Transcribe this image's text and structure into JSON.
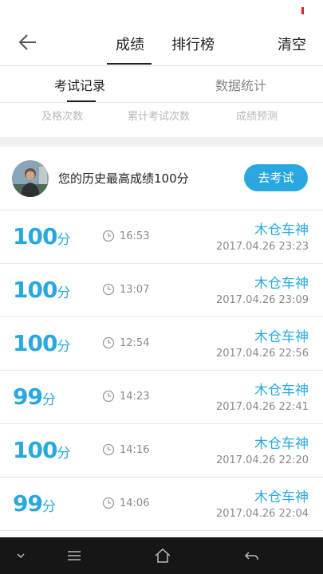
{
  "header": {
    "tabs": [
      {
        "label": "成绩",
        "active": true
      },
      {
        "label": "排行榜",
        "active": false
      }
    ],
    "clear_label": "清空"
  },
  "subtabs": [
    {
      "label": "考试记录",
      "active": true
    },
    {
      "label": "数据统计",
      "active": false
    }
  ],
  "stats_labels": [
    "及格次数",
    "累计考试次数",
    "成绩预测"
  ],
  "best": {
    "text": "您的历史最高成绩100分",
    "button_label": "去考试"
  },
  "records": [
    {
      "score": "100",
      "unit": "分",
      "duration": "16:53",
      "user": "木仓车神",
      "datetime": "2017.04.26  23:23"
    },
    {
      "score": "100",
      "unit": "分",
      "duration": "13:07",
      "user": "木仓车神",
      "datetime": "2017.04.26  23:09"
    },
    {
      "score": "100",
      "unit": "分",
      "duration": "12:54",
      "user": "木仓车神",
      "datetime": "2017.04.26  22:56"
    },
    {
      "score": "99",
      "unit": "分",
      "duration": "14:23",
      "user": "木仓车神",
      "datetime": "2017.04.26  22:41"
    },
    {
      "score": "100",
      "unit": "分",
      "duration": "14:16",
      "user": "木仓车神",
      "datetime": "2017.04.26  22:20"
    },
    {
      "score": "99",
      "unit": "分",
      "duration": "14:06",
      "user": "木仓车神",
      "datetime": "2017.04.26  22:04"
    }
  ],
  "colors": {
    "accent": "#29a8df",
    "navbar": "#161616"
  },
  "icons": {
    "back": "back-arrow-icon",
    "clock": "clock-icon",
    "nav": [
      "chevron-down-icon",
      "menu-icon",
      "home-icon",
      "back-icon"
    ]
  }
}
